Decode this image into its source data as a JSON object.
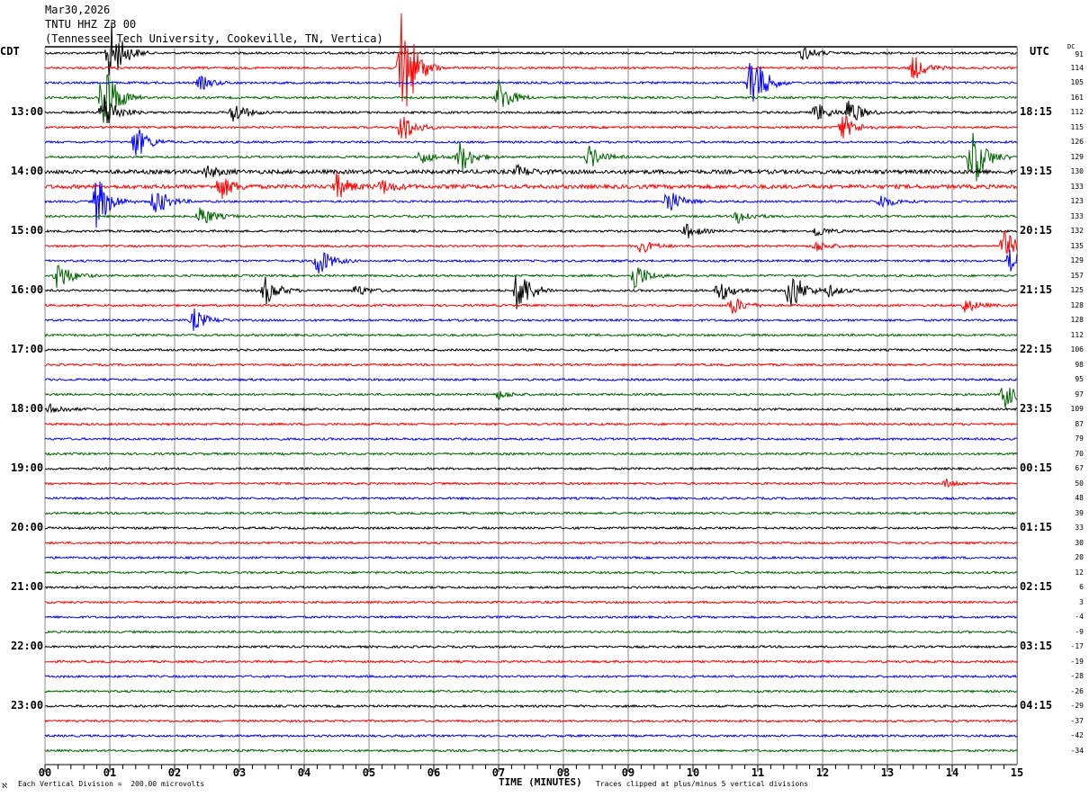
{
  "header": {
    "date": "Mar30,2026",
    "station": "TNTU HHZ Z3 00",
    "location": "(Tennessee Tech University, Cookeville, TN, Vertica)"
  },
  "left_tz": "CDT",
  "right_tz": "UTC",
  "dc_label": "DC",
  "footer": {
    "scale": "Each Vertical Division =  200.00 microvolts",
    "xlabel": "TIME (MINUTES)",
    "clip": "Traces clipped at plus/minus 5 vertical divisions",
    "corner": "ℵ"
  },
  "colors": [
    "#000000",
    "#ff0000",
    "#0000ff",
    "#006400"
  ],
  "chart_data": {
    "type": "line",
    "title": "TNTU HHZ Z3 00 helicorder",
    "xlabel": "TIME (MINUTES)",
    "xlim": [
      0,
      15
    ],
    "x_ticks": [
      "00",
      "01",
      "02",
      "03",
      "04",
      "05",
      "06",
      "07",
      "08",
      "09",
      "10",
      "11",
      "12",
      "13",
      "14",
      "15"
    ],
    "left_labels": [
      {
        "row": 4,
        "text": "13:00"
      },
      {
        "row": 8,
        "text": "14:00"
      },
      {
        "row": 12,
        "text": "15:00"
      },
      {
        "row": 16,
        "text": "16:00"
      },
      {
        "row": 20,
        "text": "17:00"
      },
      {
        "row": 24,
        "text": "18:00"
      },
      {
        "row": 28,
        "text": "19:00"
      },
      {
        "row": 32,
        "text": "20:00"
      },
      {
        "row": 36,
        "text": "21:00"
      },
      {
        "row": 40,
        "text": "22:00"
      },
      {
        "row": 44,
        "text": "23:00"
      }
    ],
    "right_labels": [
      {
        "row": 4,
        "text": "18:15"
      },
      {
        "row": 8,
        "text": "19:15"
      },
      {
        "row": 12,
        "text": "20:15"
      },
      {
        "row": 16,
        "text": "21:15"
      },
      {
        "row": 20,
        "text": "22:15"
      },
      {
        "row": 24,
        "text": "23:15"
      },
      {
        "row": 28,
        "text": "00:15"
      },
      {
        "row": 32,
        "text": "01:15"
      },
      {
        "row": 36,
        "text": "02:15"
      },
      {
        "row": 40,
        "text": "03:15"
      },
      {
        "row": 44,
        "text": "04:15"
      }
    ],
    "dc_offsets": [
      "91",
      "114",
      "105",
      "161",
      "112",
      "115",
      "126",
      "129",
      "130",
      "133",
      "123",
      "133",
      "132",
      "135",
      "129",
      "157",
      "125",
      "128",
      "128",
      "112",
      "106",
      "98",
      "95",
      "97",
      "109",
      "87",
      "79",
      "70",
      "67",
      "50",
      "48",
      "39",
      "33",
      "30",
      "20",
      "12",
      "6",
      "3",
      "-4",
      "-9",
      "-17",
      "-19",
      "-28",
      "-26",
      "-29",
      "-37",
      "-42",
      "-34"
    ],
    "row_count": 48,
    "events": [
      {
        "row": 0,
        "min": 1.0,
        "amp": 2.5
      },
      {
        "row": 0,
        "min": 11.7,
        "amp": 0.5
      },
      {
        "row": 1,
        "min": 5.5,
        "amp": 5
      },
      {
        "row": 1,
        "min": 13.4,
        "amp": 0.9
      },
      {
        "row": 2,
        "min": 2.4,
        "amp": 0.5
      },
      {
        "row": 2,
        "min": 10.9,
        "amp": 2.5
      },
      {
        "row": 3,
        "min": 0.9,
        "amp": 3
      },
      {
        "row": 3,
        "min": 7.0,
        "amp": 1.3
      },
      {
        "row": 4,
        "min": 0.9,
        "amp": 1.5
      },
      {
        "row": 4,
        "min": 2.9,
        "amp": 0.8
      },
      {
        "row": 4,
        "min": 11.9,
        "amp": 0.7
      },
      {
        "row": 4,
        "min": 12.4,
        "amp": 1
      },
      {
        "row": 5,
        "min": 5.5,
        "amp": 1.2
      },
      {
        "row": 5,
        "min": 12.3,
        "amp": 1
      },
      {
        "row": 6,
        "min": 1.4,
        "amp": 1.2
      },
      {
        "row": 7,
        "min": 5.8,
        "amp": 0.5
      },
      {
        "row": 7,
        "min": 6.4,
        "amp": 1.2
      },
      {
        "row": 7,
        "min": 8.4,
        "amp": 0.8
      },
      {
        "row": 7,
        "min": 14.3,
        "amp": 2.5
      },
      {
        "row": 8,
        "min": 2.5,
        "amp": 0.4
      },
      {
        "row": 8,
        "min": 7.3,
        "amp": 0.4
      },
      {
        "row": 9,
        "min": 2.7,
        "amp": 0.9
      },
      {
        "row": 9,
        "min": 4.5,
        "amp": 0.9
      },
      {
        "row": 9,
        "min": 5.2,
        "amp": 0.5
      },
      {
        "row": 10,
        "min": 0.8,
        "amp": 2
      },
      {
        "row": 10,
        "min": 1.7,
        "amp": 1.1
      },
      {
        "row": 10,
        "min": 9.6,
        "amp": 1
      },
      {
        "row": 10,
        "min": 12.9,
        "amp": 0.5
      },
      {
        "row": 11,
        "min": 2.4,
        "amp": 0.8
      },
      {
        "row": 11,
        "min": 10.7,
        "amp": 0.5
      },
      {
        "row": 12,
        "min": 9.9,
        "amp": 0.5
      },
      {
        "row": 12,
        "min": 11.9,
        "amp": 0.4
      },
      {
        "row": 13,
        "min": 9.2,
        "amp": 0.5
      },
      {
        "row": 13,
        "min": 11.9,
        "amp": 0.4
      },
      {
        "row": 13,
        "min": 14.8,
        "amp": 1.1
      },
      {
        "row": 14,
        "min": 4.2,
        "amp": 1.2
      },
      {
        "row": 14,
        "min": 14.9,
        "amp": 0.9
      },
      {
        "row": 15,
        "min": 0.2,
        "amp": 1.1
      },
      {
        "row": 15,
        "min": 9.1,
        "amp": 1
      },
      {
        "row": 16,
        "min": 3.4,
        "amp": 1
      },
      {
        "row": 16,
        "min": 4.8,
        "amp": 0.4
      },
      {
        "row": 16,
        "min": 7.3,
        "amp": 1.8
      },
      {
        "row": 16,
        "min": 10.4,
        "amp": 0.8
      },
      {
        "row": 16,
        "min": 11.5,
        "amp": 1.6
      },
      {
        "row": 16,
        "min": 12.1,
        "amp": 0.4
      },
      {
        "row": 17,
        "min": 10.6,
        "amp": 0.7
      },
      {
        "row": 17,
        "min": 14.2,
        "amp": 0.5
      },
      {
        "row": 18,
        "min": 2.3,
        "amp": 0.8
      },
      {
        "row": 23,
        "min": 7.0,
        "amp": 0.3
      },
      {
        "row": 23,
        "min": 14.8,
        "amp": 1
      },
      {
        "row": 24,
        "min": 0.1,
        "amp": 0.4
      },
      {
        "row": 29,
        "min": 13.9,
        "amp": 0.3
      }
    ]
  }
}
